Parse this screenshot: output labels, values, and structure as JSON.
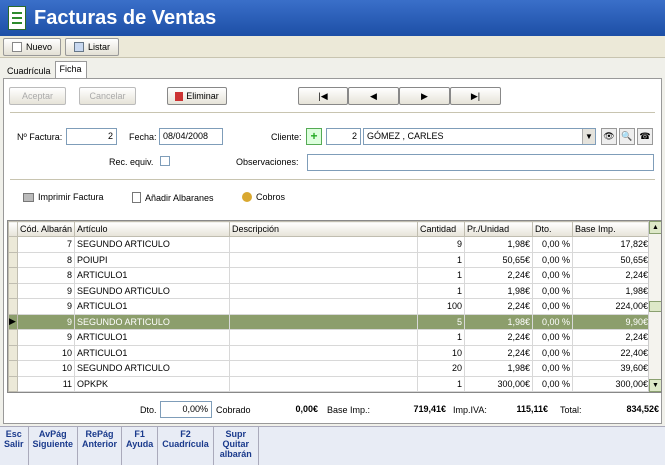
{
  "window": {
    "title": "Facturas de Ventas"
  },
  "toolbar": {
    "nuevo": "Nuevo",
    "listar": "Listar"
  },
  "tabs": [
    {
      "label": "Cuadrícula"
    },
    {
      "label": "Ficha"
    }
  ],
  "form": {
    "aceptar": "Aceptar",
    "cancelar": "Cancelar",
    "eliminar": "Eliminar",
    "nav": [
      "|◀",
      "◀",
      "▶",
      "▶|"
    ],
    "nfactura_label": "Nº Factura:",
    "nfactura_value": "2",
    "fecha_label": "Fecha:",
    "fecha_value": "08/04/2008",
    "cliente_label": "Cliente:",
    "cliente_code": "2",
    "cliente_name": "GÓMEZ ,   CARLES",
    "rec_equiv_label": "Rec. equiv.",
    "observaciones_label": "Observaciones:",
    "observaciones_value": ""
  },
  "actions": {
    "imprimir": "Imprimir Factura",
    "anadir": "Añadir Albaranes",
    "cobros": "Cobros"
  },
  "grid": {
    "headers": [
      "Cód. Albarán",
      "Artículo",
      "Descripción",
      "Cantidad",
      "Pr./Unidad",
      "Dto.",
      "Base Imp."
    ],
    "rows": [
      [
        "7",
        "SEGUNDO ARTICULO",
        "",
        "9",
        "1,98€",
        "0,00 %",
        "17,82€"
      ],
      [
        "8",
        "POIUPI",
        "",
        "1",
        "50,65€",
        "0,00 %",
        "50,65€"
      ],
      [
        "8",
        "ARTICULO1",
        "",
        "1",
        "2,24€",
        "0,00 %",
        "2,24€"
      ],
      [
        "9",
        "SEGUNDO ARTICULO",
        "",
        "1",
        "1,98€",
        "0,00 %",
        "1,98€"
      ],
      [
        "9",
        "ARTICULO1",
        "",
        "100",
        "2,24€",
        "0,00 %",
        "224,00€"
      ],
      [
        "9",
        "SEGUNDO ARTICULO",
        "",
        "5",
        "1,98€",
        "0,00 %",
        "9,90€"
      ],
      [
        "9",
        "ARTICULO1",
        "",
        "1",
        "2,24€",
        "0,00 %",
        "2,24€"
      ],
      [
        "10",
        "ARTICULO1",
        "",
        "10",
        "2,24€",
        "0,00 %",
        "22,40€"
      ],
      [
        "10",
        "SEGUNDO ARTICULO",
        "",
        "20",
        "1,98€",
        "0,00 %",
        "39,60€"
      ],
      [
        "11",
        "OPKPK",
        "",
        "1",
        "300,00€",
        "0,00 %",
        "300,00€"
      ]
    ],
    "selected_row": 5
  },
  "totals": {
    "dto_label": "Dto.",
    "dto_value": "0,00%",
    "cobrado_label": "Cobrado",
    "cobrado_value": "0,00€",
    "base_label": "Base Imp.:",
    "base_value": "719,41€",
    "iva_label": "Imp.IVA:",
    "iva_value": "115,11€",
    "total_label": "Total:",
    "total_value": "834,52€"
  },
  "function_keys": [
    {
      "key": "Esc",
      "label": "Salir"
    },
    {
      "key": "AvPág",
      "label": "Siguiente"
    },
    {
      "key": "RePág",
      "label": "Anterior"
    },
    {
      "key": "F1",
      "label": "Ayuda"
    },
    {
      "key": "F2",
      "label": "Cuadrícula"
    },
    {
      "key": "Supr",
      "label": "Quitar albarán"
    }
  ]
}
